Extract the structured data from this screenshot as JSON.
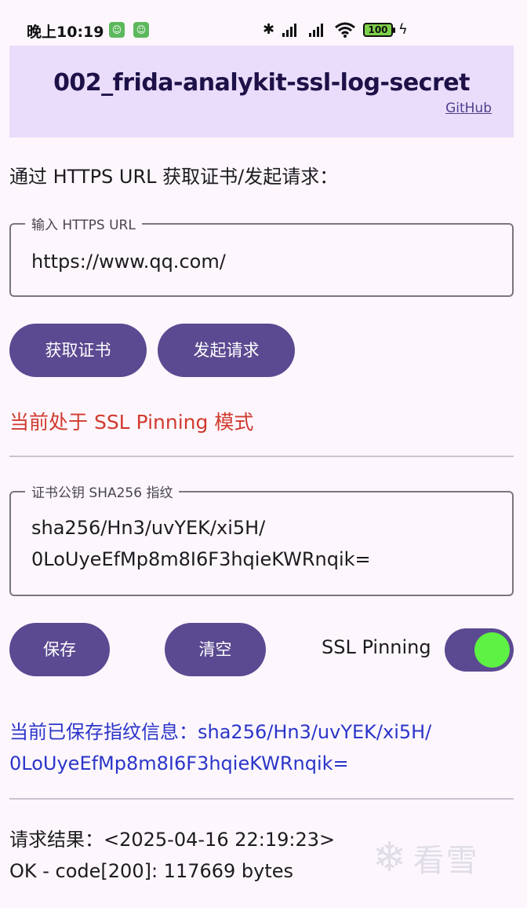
{
  "status_bar": {
    "time": "晚上10:19",
    "battery": "100"
  },
  "header": {
    "title": "002_frida-analykit-ssl-log-secret",
    "github_link": "GitHub"
  },
  "main": {
    "section_label": "通过 HTTPS URL 获取证书/发起请求：",
    "url_field": {
      "label": "输入 HTTPS URL",
      "value": "https://www.qq.com/"
    },
    "buttons": {
      "get_cert": "获取证书",
      "send_request": "发起请求",
      "save": "保存",
      "clear": "清空"
    },
    "pinning_mode_text": "当前处于 SSL Pinning 模式",
    "fingerprint_field": {
      "label": "证书公钥 SHA256 指纹",
      "line1": "sha256/Hn3/uvYEK/xi5H/",
      "line2": "0LoUyeEfMp8m8I6F3hqieKWRnqik="
    },
    "ssl_pinning_toggle": {
      "label": "SSL Pinning",
      "on": true
    },
    "saved_info": {
      "line1": "当前已保存指纹信息：sha256/Hn3/uvYEK/xi5H/",
      "line2": "0LoUyeEfMp8m8I6F3hqieKWRnqik="
    },
    "result": {
      "line1": "请求结果：<2025-04-16 22:19:23>",
      "line2": "OK - code[200]: 117669 bytes"
    }
  },
  "watermark": {
    "text": "看雪",
    "icon": "snowflake-icon"
  },
  "colors": {
    "primary": "#5b4a91",
    "header_bg": "#e9ddfb",
    "pinning_text": "#d13a2e",
    "saved_info_text": "#2b35c9",
    "switch_thumb": "#5ef244"
  }
}
